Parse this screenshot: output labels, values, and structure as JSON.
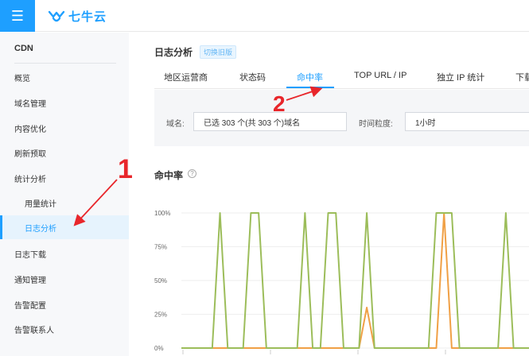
{
  "app": {
    "logo_text": "七牛云",
    "menu_icon": "menu-icon"
  },
  "sidebar": {
    "title": "CDN",
    "items": [
      {
        "label": "概览"
      },
      {
        "label": "域名管理"
      },
      {
        "label": "内容优化"
      },
      {
        "label": "刷新预取"
      },
      {
        "label": "统计分析"
      },
      {
        "label": "用量统计"
      },
      {
        "label": "日志分析"
      },
      {
        "label": "日志下载"
      },
      {
        "label": "通知管理"
      },
      {
        "label": "告警配置"
      },
      {
        "label": "告警联系人"
      }
    ]
  },
  "header": {
    "title": "日志分析",
    "switch_label": "切换旧版"
  },
  "tabs": [
    {
      "label": "地区运营商"
    },
    {
      "label": "状态码"
    },
    {
      "label": "命中率",
      "active": true
    },
    {
      "label": "TOP URL / IP"
    },
    {
      "label": "独立 IP 统计"
    },
    {
      "label": "下载"
    }
  ],
  "filters": {
    "domain_label": "域名:",
    "domain_value": "已选 303 个(共 303 个)域名",
    "granularity_label": "时间粒度:",
    "granularity_value": "1小时"
  },
  "section": {
    "title": "命中率",
    "help_icon": "help-circle-icon"
  },
  "annotations": {
    "one": "1",
    "two": "2"
  },
  "colors": {
    "accent": "#1e9fff",
    "series_green": "#9cbd5a",
    "series_orange": "#f0a045",
    "annotation_red": "#e8262b"
  },
  "chart_data": {
    "type": "line",
    "y_ticks": [
      "100%",
      "75%",
      "50%",
      "25%",
      "0%"
    ],
    "ylim": [
      0,
      100
    ],
    "x": [
      0,
      1,
      2,
      3,
      4,
      5,
      6,
      7,
      8,
      9,
      10,
      11,
      12,
      13,
      14,
      15,
      16,
      17,
      18,
      19,
      20,
      21,
      22,
      23,
      24,
      25,
      26,
      27,
      28,
      29,
      30,
      31,
      32,
      33,
      34,
      35,
      36,
      37,
      38,
      39,
      40,
      41,
      42,
      43,
      44,
      45
    ],
    "series": [
      {
        "color": "#9cbd5a",
        "values": [
          0,
          0,
          0,
          0,
          0,
          100,
          0,
          0,
          0,
          100,
          100,
          0,
          0,
          0,
          0,
          0,
          100,
          0,
          0,
          100,
          100,
          0,
          0,
          0,
          100,
          0,
          0,
          0,
          0,
          0,
          0,
          0,
          0,
          100,
          100,
          100,
          0,
          0,
          0,
          0,
          0,
          0,
          100,
          0,
          0,
          0
        ]
      },
      {
        "color": "#f0a045",
        "values": [
          0,
          0,
          0,
          0,
          0,
          0,
          0,
          0,
          0,
          0,
          0,
          0,
          0,
          0,
          0,
          0,
          0,
          0,
          0,
          0,
          0,
          0,
          0,
          0,
          30,
          0,
          0,
          0,
          0,
          0,
          0,
          0,
          0,
          0,
          100,
          0,
          0,
          0,
          0,
          0,
          0,
          0,
          0,
          0,
          0,
          0
        ]
      }
    ]
  }
}
